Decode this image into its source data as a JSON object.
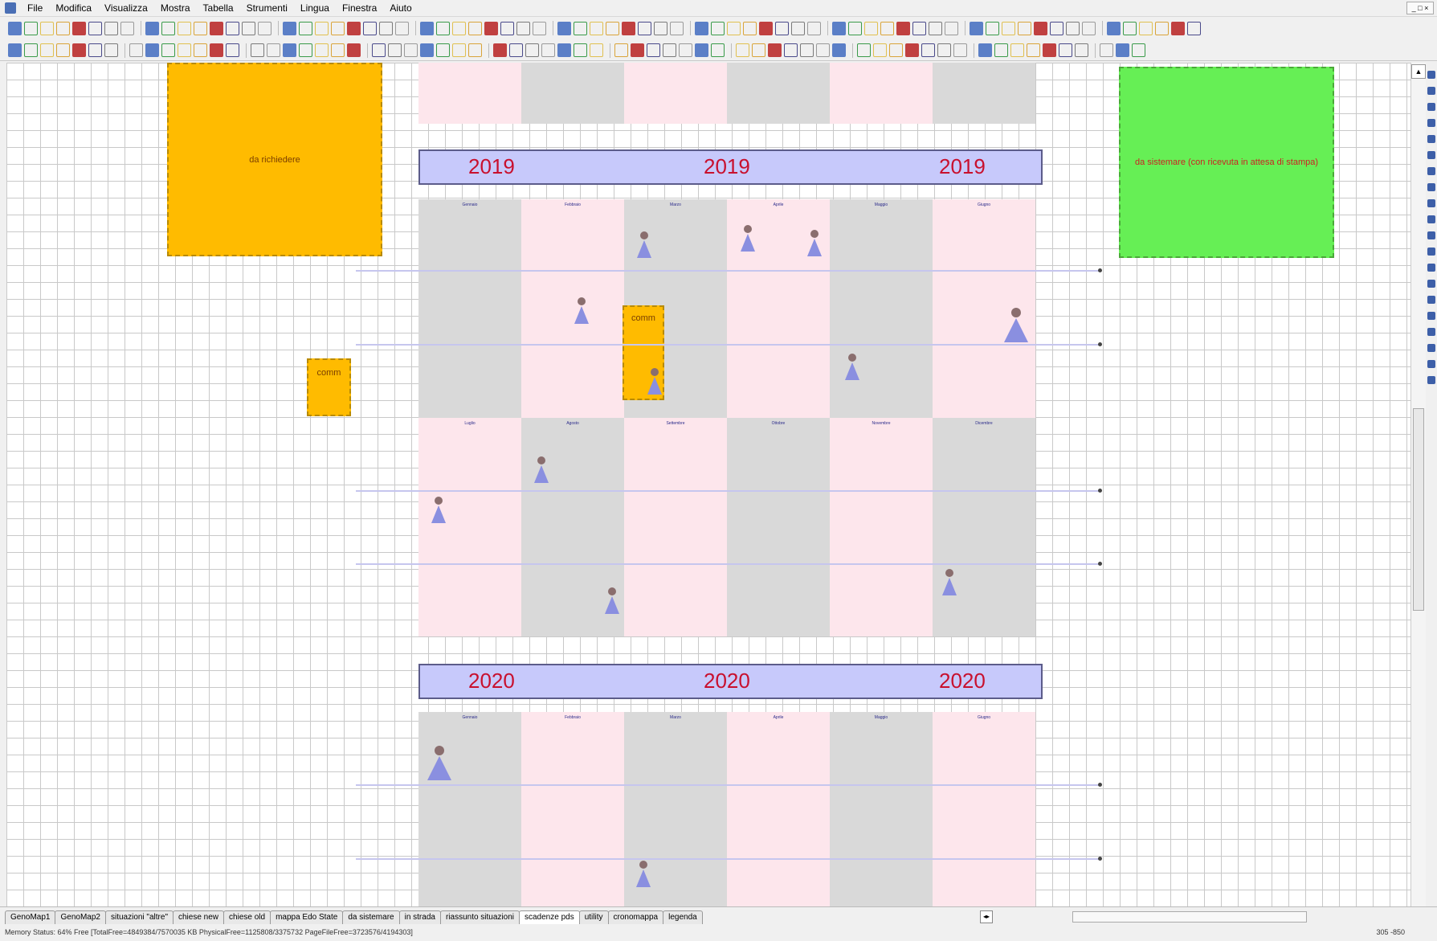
{
  "menu": [
    "File",
    "Modifica",
    "Visualizza",
    "Mostra",
    "Tabella",
    "Strumenti",
    "Lingua",
    "Finestra",
    "Aiuto"
  ],
  "boxes": {
    "top_left": "da richiedere",
    "top_right": "da sistemare (con ricevuta in attesa di stampa)",
    "comm_left": "comm",
    "comm_middle": "comm"
  },
  "banners": [
    {
      "years": [
        "2019",
        "2019",
        "2019"
      ]
    },
    {
      "years": [
        "2020",
        "2020",
        "2020"
      ]
    }
  ],
  "months_row1": [
    "Gennaio",
    "Febbraio",
    "Marzo",
    "Aprile",
    "Maggio",
    "Giugno"
  ],
  "months_row2": [
    "Luglio",
    "Agosto",
    "Settembre",
    "Ottobre",
    "Novembre",
    "Dicembre"
  ],
  "tabs": [
    "GenoMap1",
    "GenoMap2",
    "situazioni \"altre\"",
    "chiese new",
    "chiese old",
    "mappa Edo State",
    "da sistemare",
    "in strada",
    "riassunto situazioni",
    "scadenze pds",
    "utility",
    "cronomappa",
    "legenda"
  ],
  "active_tab": "scadenze pds",
  "status": {
    "memory": "Memory Status: 64% Free [TotalFree=4849384/7570035 KB  PhysicalFree=1125808/3375732  PageFileFree=3723576/4194303]",
    "coords": "305 -850"
  }
}
